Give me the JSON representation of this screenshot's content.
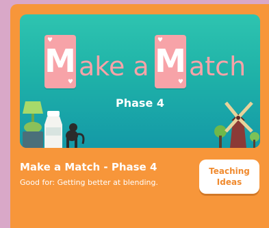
{
  "banner": {
    "title_cards": [
      {
        "glyph": "M",
        "suit": "♥"
      },
      {
        "glyph": "M",
        "suit": "♥"
      }
    ],
    "word_1": "ake a",
    "word_2": "atch",
    "phase": "Phase 4"
  },
  "info": {
    "title": "Make a Match - Phase 4",
    "subtitle": "Good for: Getting better at blending."
  },
  "actions": {
    "teaching_ideas_label": "Teaching Ideas"
  },
  "colors": {
    "card_bg": "#f7963a",
    "banner_top": "#2ec4b0",
    "banner_bottom": "#1499a7",
    "pink": "#f7a3a8",
    "page_bg": "#d9a8c8",
    "button_text": "#f08a2e"
  }
}
